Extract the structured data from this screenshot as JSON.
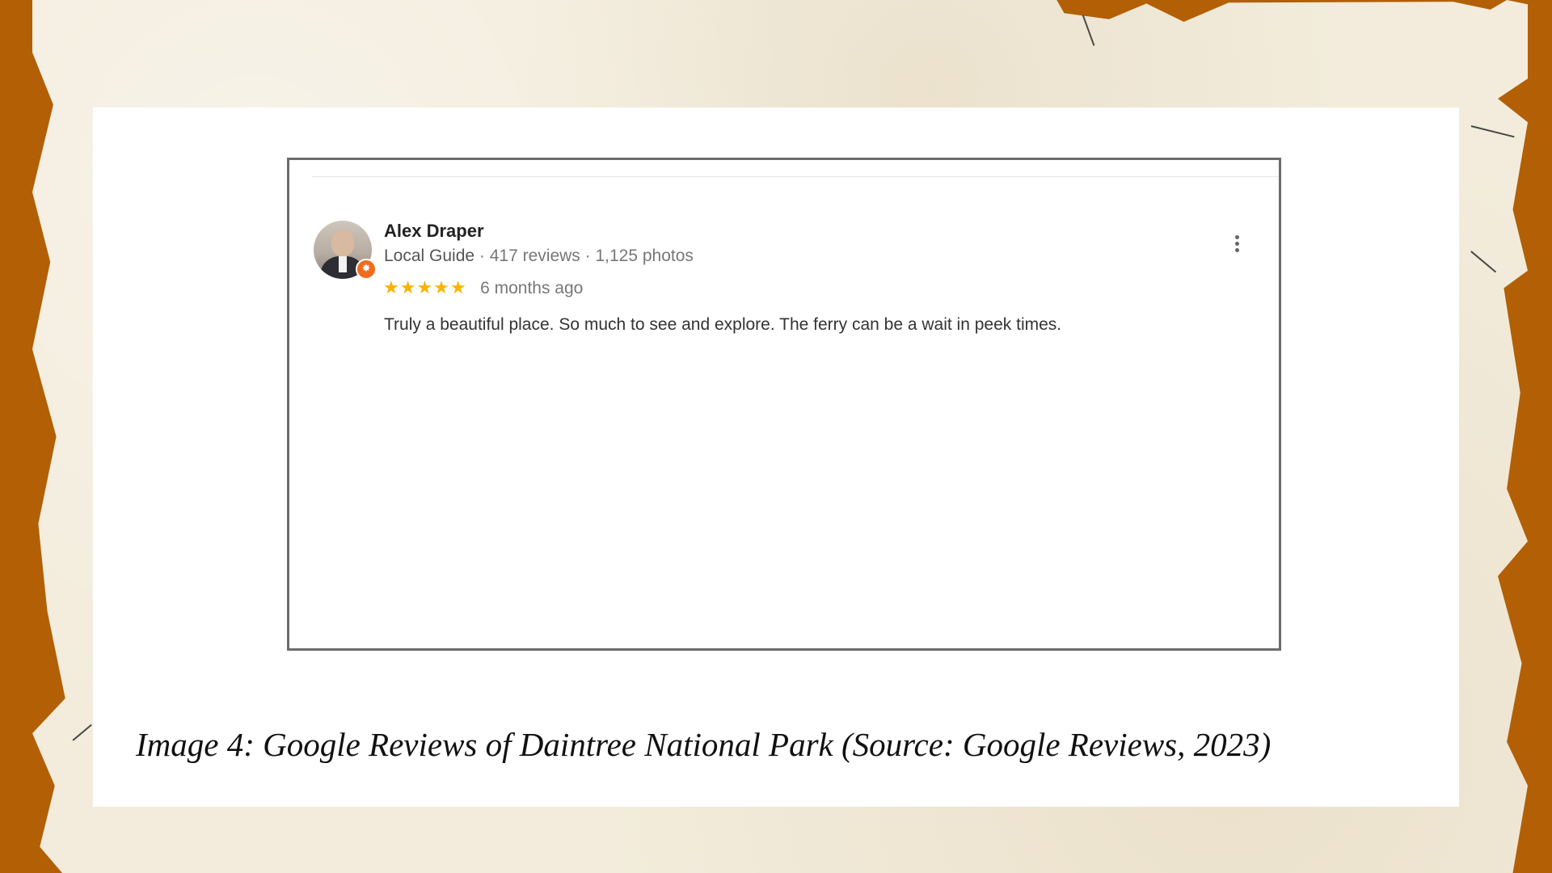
{
  "review": {
    "reviewer_name": "Alex Draper",
    "badge": "Local Guide",
    "meta_stats": "· 417 reviews · 1,125 photos",
    "stars": "★★★★★",
    "rating": 5,
    "time_ago": "6 months ago",
    "text": "Truly a beautiful place. So much to see and explore.  The ferry can be a wait in peek times.",
    "more_icon": "more-vert-icon"
  },
  "caption": "Image 4: Google Reviews of Daintree National Park (Source: Google Reviews, 2023)",
  "colors": {
    "background": "#b25f06",
    "paper": "#f3ecdc",
    "star": "#f6b400",
    "badge": "#f26b1d"
  }
}
